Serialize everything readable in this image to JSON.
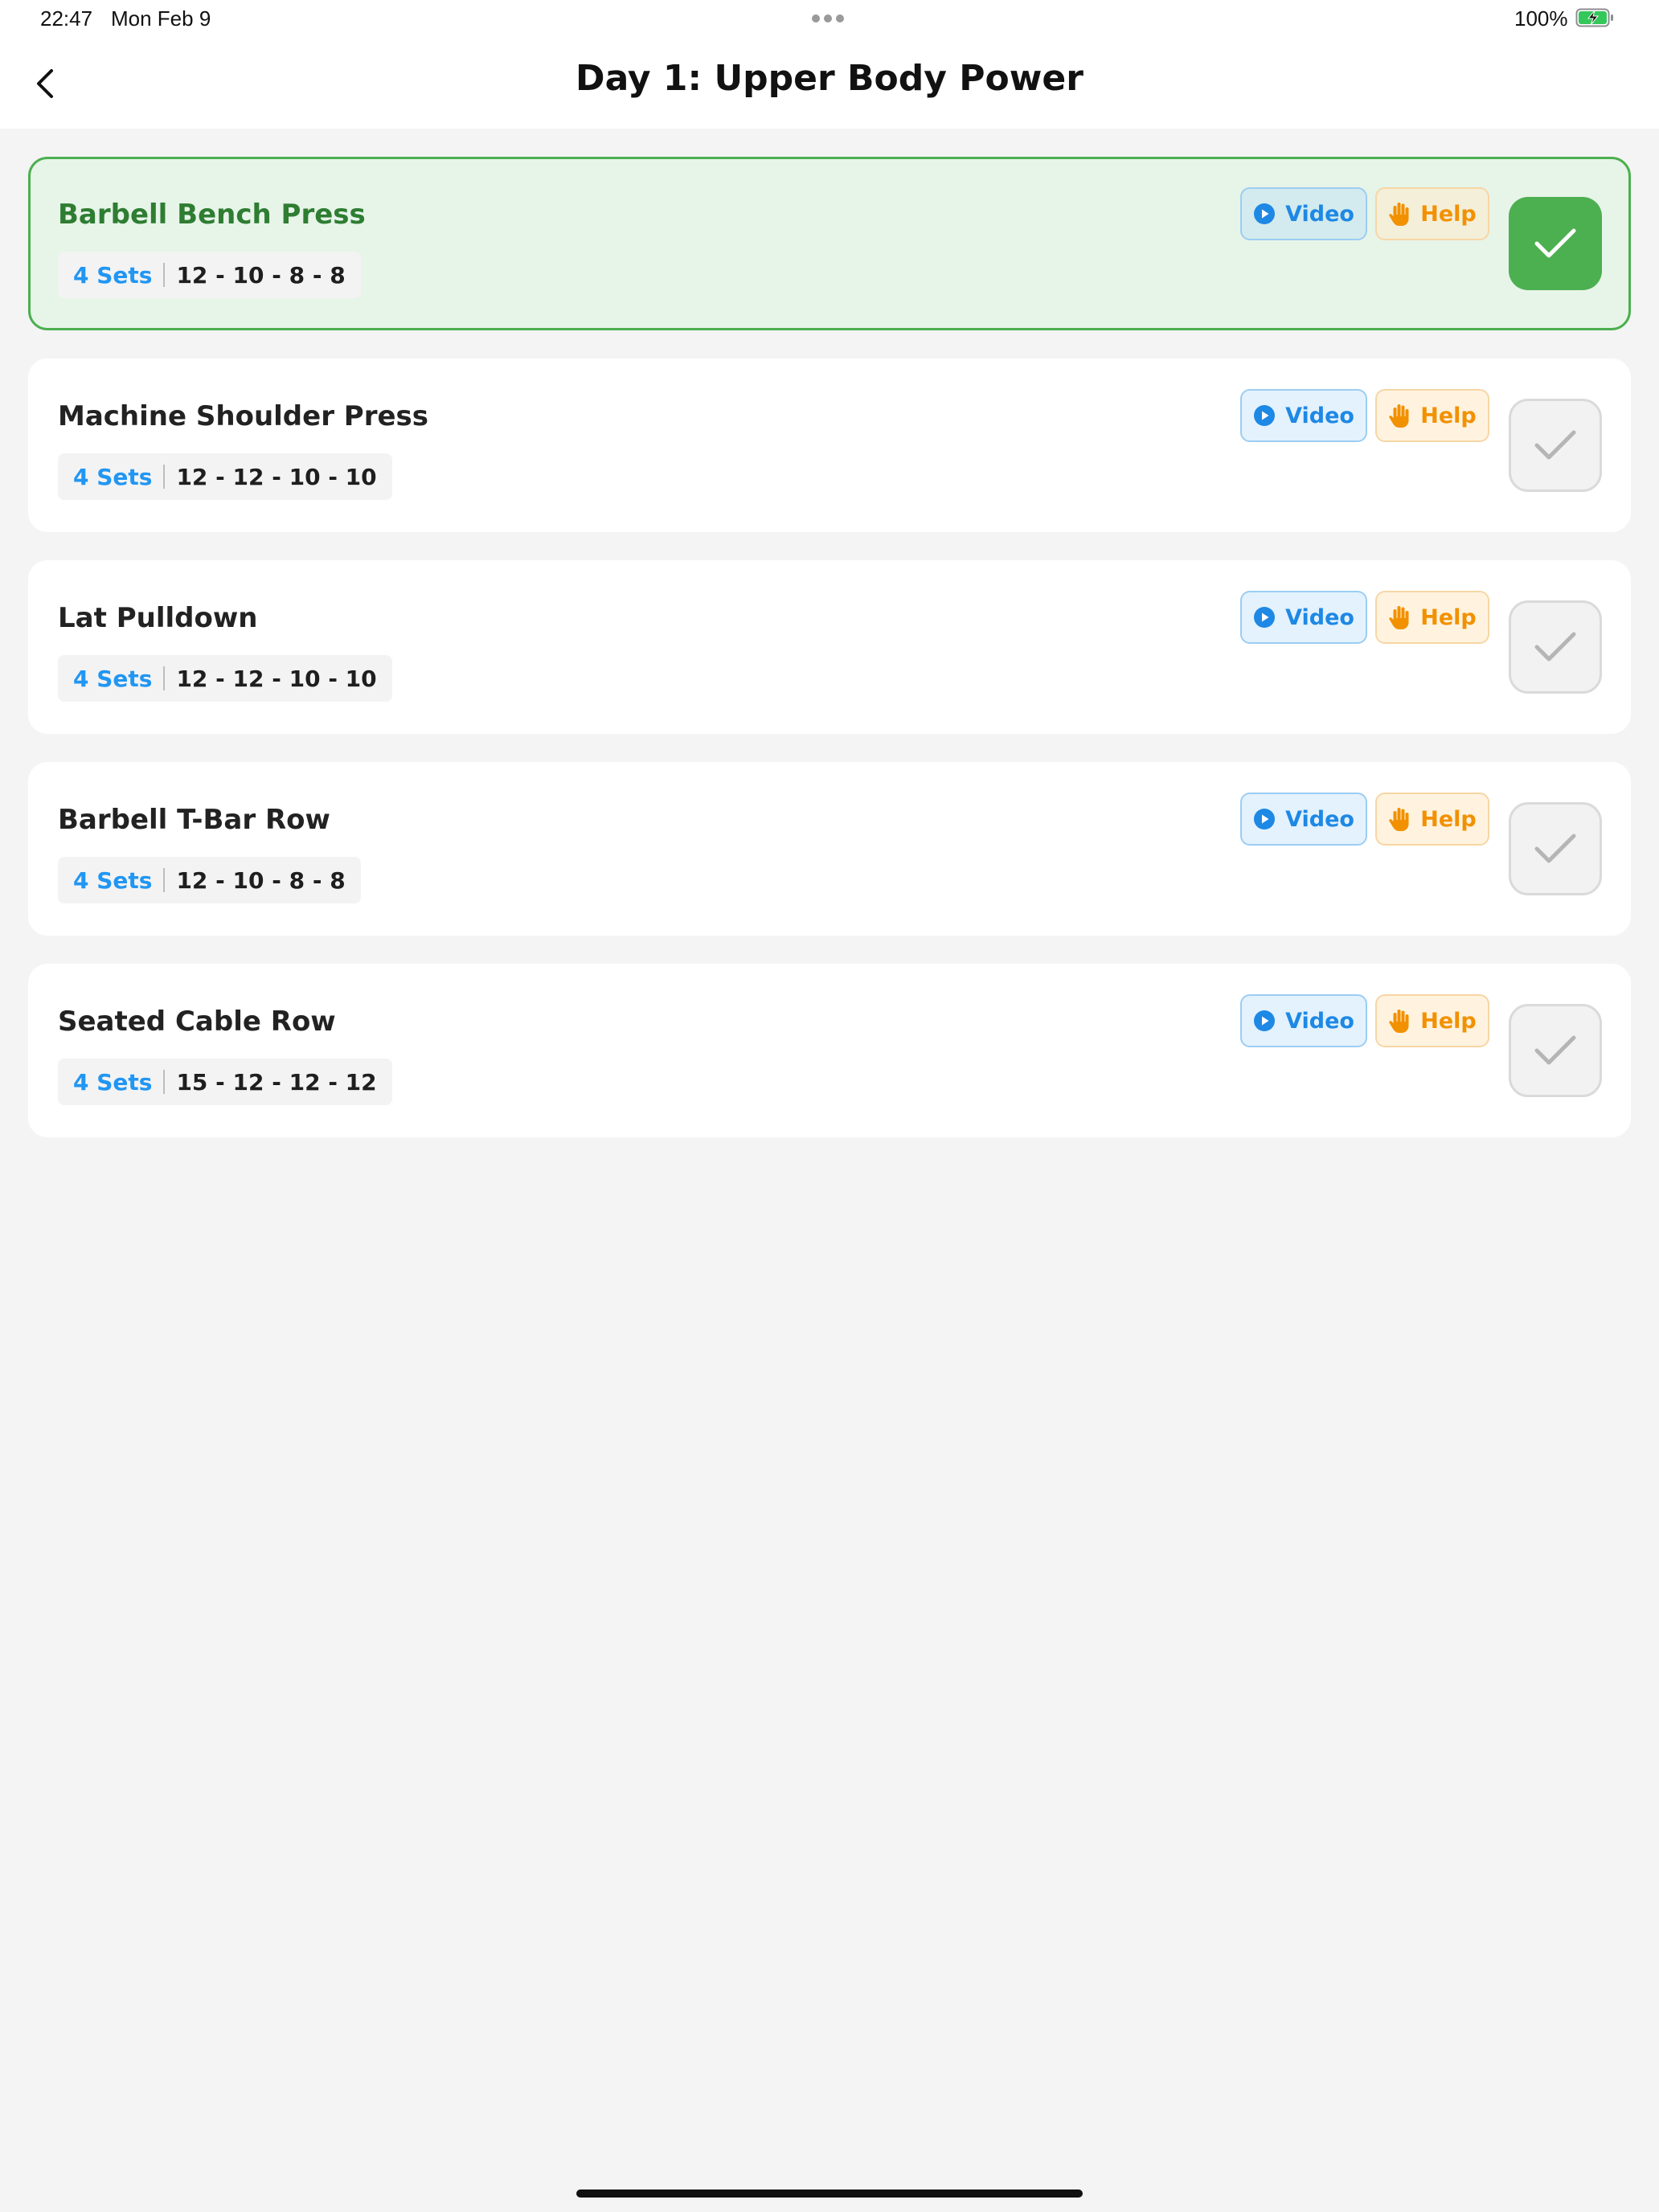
{
  "status_bar": {
    "time": "22:47",
    "date": "Mon Feb 9",
    "battery_percent": "100%",
    "battery_state": "charging",
    "battery_color": "#34C759"
  },
  "header": {
    "back_icon": "chevron-left-icon",
    "title": "Day 1: Upper Body Power"
  },
  "colors": {
    "accent_blue": "#2196F3",
    "accent_orange": "#F29100",
    "done_green": "#4CAF50",
    "done_text_green": "#2E7D32",
    "background": "#F4F4F4"
  },
  "actions": {
    "video_label": "Video",
    "video_icon": "play-circle-icon",
    "help_label": "Help",
    "help_icon": "hand-icon",
    "check_icon": "checkmark-icon"
  },
  "exercises": [
    {
      "name": "Barbell Bench Press",
      "sets": "4 Sets",
      "reps": "12 - 10 - 8 - 8",
      "completed": true
    },
    {
      "name": "Machine Shoulder Press",
      "sets": "4 Sets",
      "reps": "12 - 12 - 10 - 10",
      "completed": false
    },
    {
      "name": "Lat Pulldown",
      "sets": "4 Sets",
      "reps": "12 - 12 - 10 - 10",
      "completed": false
    },
    {
      "name": "Barbell T-Bar Row",
      "sets": "4 Sets",
      "reps": "12 - 10 - 8 - 8",
      "completed": false
    },
    {
      "name": "Seated Cable Row",
      "sets": "4 Sets",
      "reps": "15 - 12 - 12 - 12",
      "completed": false
    }
  ]
}
